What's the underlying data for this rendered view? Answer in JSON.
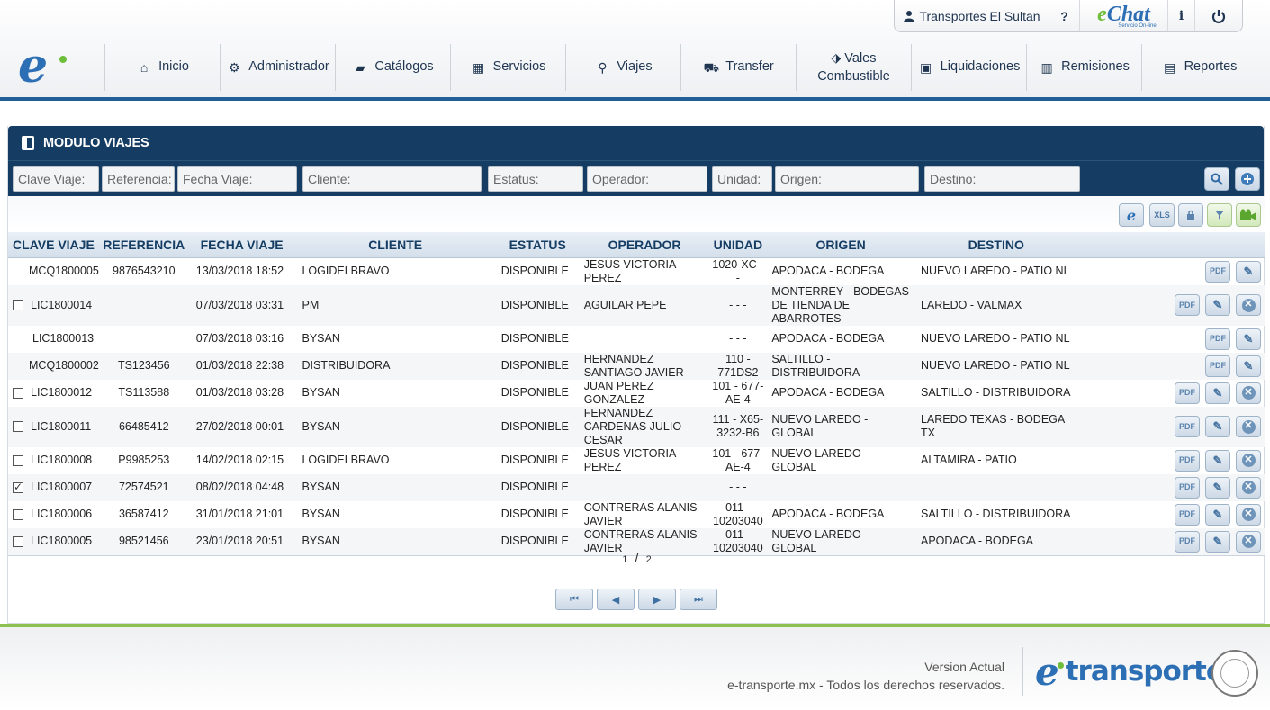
{
  "topbar": {
    "user": "Transportes El Sultan",
    "help": "?",
    "chat_logo": "Chat",
    "chat_sub": "Servicio On-line",
    "info": "i"
  },
  "nav": [
    {
      "label": "Inicio",
      "icon": "home-icon"
    },
    {
      "label": "Administrador",
      "icon": "gears-icon"
    },
    {
      "label": "Catálogos",
      "icon": "book-icon"
    },
    {
      "label": "Servicios",
      "icon": "calendar-icon"
    },
    {
      "label": "Viajes",
      "icon": "map-marker-icon"
    },
    {
      "label": "Transfer",
      "icon": "truck-icon"
    },
    {
      "label": "Vales",
      "label2": "Combustible",
      "icon": "tag-icon"
    },
    {
      "label": "Liquidaciones",
      "icon": "money-icon"
    },
    {
      "label": "Remisiones",
      "icon": "building-icon"
    },
    {
      "label": "Reportes",
      "icon": "file-icon"
    }
  ],
  "panel": {
    "title": "MODULO VIAJES"
  },
  "filters": {
    "clave": "Clave Viaje:",
    "referencia": "Referencia:",
    "fecha": "Fecha Viaje:",
    "cliente": "Cliente:",
    "estatus": "Estatus:",
    "operador": "Operador:",
    "unidad": "Unidad:",
    "origen": "Origen:",
    "destino": "Destino:"
  },
  "toolbar": {
    "xls": "XLS"
  },
  "columns": [
    "CLAVE VIAJE",
    "REFERENCIA",
    "FECHA VIAJE",
    "CLIENTE",
    "ESTATUS",
    "OPERADOR",
    "UNIDAD",
    "ORIGEN",
    "DESTINO"
  ],
  "rows": [
    {
      "checkbox": false,
      "checked": false,
      "clave": "MCQ1800005",
      "referencia": "9876543210",
      "fecha": "13/03/2018 18:52",
      "cliente": "LOGIDELBRAVO",
      "estatus": "DISPONIBLE",
      "operador": "JESUS VICTORIA PEREZ",
      "unidad": "1020-XC - -",
      "origen": "APODACA - BODEGA",
      "destino": "NUEVO LAREDO - PATIO NL",
      "cancel": false
    },
    {
      "checkbox": true,
      "checked": false,
      "clave": "LIC1800014",
      "referencia": "",
      "fecha": "07/03/2018 03:31",
      "cliente": "PM",
      "estatus": "DISPONIBLE",
      "operador": "AGUILAR PEPE",
      "unidad": "- - -",
      "origen": "MONTERREY - BODEGAS DE TIENDA DE ABARROTES",
      "destino": "LAREDO - VALMAX",
      "cancel": true
    },
    {
      "checkbox": false,
      "checked": false,
      "clave": "LIC1800013",
      "referencia": "",
      "fecha": "07/03/2018 03:16",
      "cliente": "BYSAN",
      "estatus": "DISPONIBLE",
      "operador": "",
      "unidad": "- - -",
      "origen": "APODACA - BODEGA",
      "destino": "NUEVO LAREDO - PATIO NL",
      "cancel": false
    },
    {
      "checkbox": false,
      "checked": false,
      "clave": "MCQ1800002",
      "referencia": "TS123456",
      "fecha": "01/03/2018 22:38",
      "cliente": "DISTRIBUIDORA",
      "estatus": "DISPONIBLE",
      "operador": "HERNANDEZ SANTIAGO JAVIER",
      "unidad": "110 - 771DS2",
      "origen": "SALTILLO - DISTRIBUIDORA",
      "destino": "NUEVO LAREDO - PATIO NL",
      "cancel": false
    },
    {
      "checkbox": true,
      "checked": false,
      "clave": "LIC1800012",
      "referencia": "TS113588",
      "fecha": "01/03/2018 03:28",
      "cliente": "BYSAN",
      "estatus": "DISPONIBLE",
      "operador": "JUAN PEREZ GONZALEZ",
      "unidad": "101 - 677-AE-4",
      "origen": "APODACA - BODEGA",
      "destino": "SALTILLO - DISTRIBUIDORA",
      "cancel": true
    },
    {
      "checkbox": true,
      "checked": false,
      "clave": "LIC1800011",
      "referencia": "66485412",
      "fecha": "27/02/2018 00:01",
      "cliente": "BYSAN",
      "estatus": "DISPONIBLE",
      "operador": "FERNANDEZ CARDENAS JULIO CESAR",
      "unidad": "111 - X65-3232-B6",
      "origen": "NUEVO LAREDO - GLOBAL",
      "destino": "LAREDO TEXAS - BODEGA TX",
      "cancel": true
    },
    {
      "checkbox": true,
      "checked": false,
      "clave": "LIC1800008",
      "referencia": "P9985253",
      "fecha": "14/02/2018 02:15",
      "cliente": "LOGIDELBRAVO",
      "estatus": "DISPONIBLE",
      "operador": "JESUS VICTORIA PEREZ",
      "unidad": "101 - 677-AE-4",
      "origen": "NUEVO LAREDO - GLOBAL",
      "destino": "ALTAMIRA - PATIO",
      "cancel": true
    },
    {
      "checkbox": true,
      "checked": true,
      "clave": "LIC1800007",
      "referencia": "72574521",
      "fecha": "08/02/2018 04:48",
      "cliente": "BYSAN",
      "estatus": "DISPONIBLE",
      "operador": "",
      "unidad": "- - -",
      "origen": "",
      "destino": "",
      "cancel": true
    },
    {
      "checkbox": true,
      "checked": false,
      "clave": "LIC1800006",
      "referencia": "36587412",
      "fecha": "31/01/2018 21:01",
      "cliente": "BYSAN",
      "estatus": "DISPONIBLE",
      "operador": "CONTRERAS ALANIS JAVIER",
      "unidad": "011 - 10203040",
      "origen": "APODACA - BODEGA",
      "destino": "SALTILLO - DISTRIBUIDORA",
      "cancel": true
    },
    {
      "checkbox": true,
      "checked": false,
      "clave": "LIC1800005",
      "referencia": "98521456",
      "fecha": "23/01/2018 20:51",
      "cliente": "BYSAN",
      "estatus": "DISPONIBLE",
      "operador": "CONTRERAS ALANIS JAVIER",
      "unidad": "011 - 10203040",
      "origen": "NUEVO LAREDO - GLOBAL",
      "destino": "APODACA - BODEGA",
      "cancel": true
    }
  ],
  "row_actions": {
    "pdf": "PDF"
  },
  "pager": {
    "current": "1",
    "separator": "/",
    "total": "2"
  },
  "footer": {
    "version": "Version Actual",
    "copyright": "e-transporte.mx - Todos los derechos reservados.",
    "brand": "transporte"
  }
}
